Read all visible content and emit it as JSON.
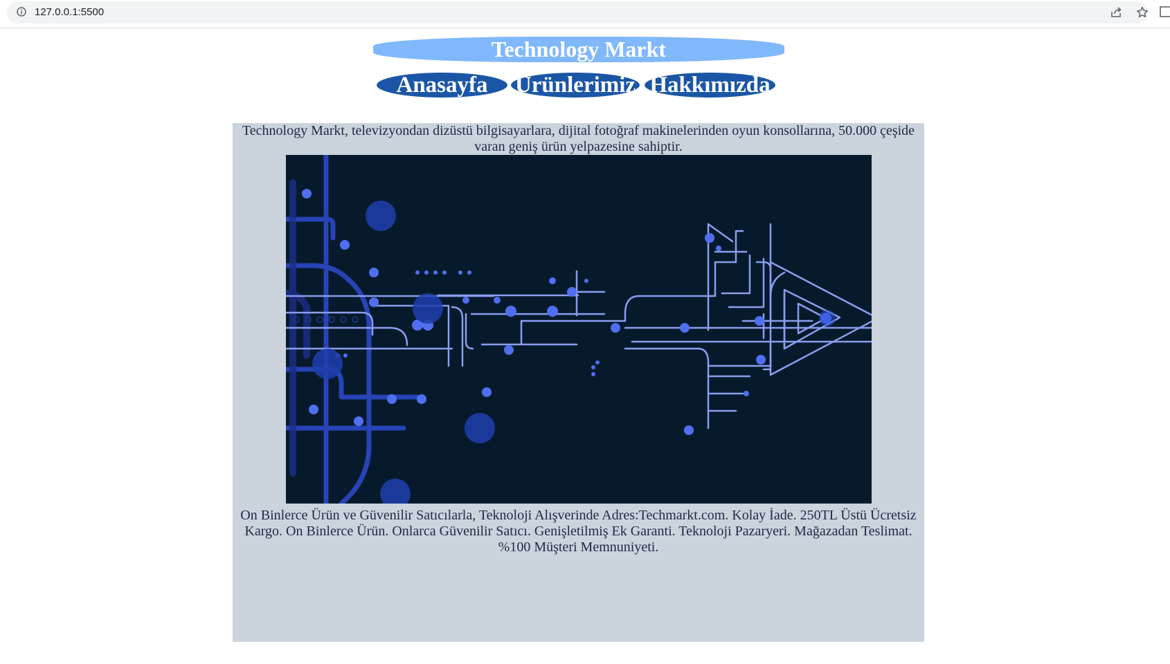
{
  "browser": {
    "url": "127.0.0.1:5500",
    "icons": [
      "info-icon",
      "share-icon",
      "star-icon",
      "side-panel-icon"
    ]
  },
  "header": {
    "title": "Technology Markt",
    "title_bg": "#80b8fc",
    "nav": [
      {
        "label": "Anasayfa"
      },
      {
        "label": "Ürünlerimiz"
      },
      {
        "label": "Hakkımızda"
      }
    ],
    "nav_bg": "#1b56a6"
  },
  "content": {
    "intro": "Technology Markt, televizyondan dizüstü bilgisayarlara, dijital fotoğraf makinelerinden oyun konsollarına, 50.000 çeşide varan geniş ürün yelpazesine sahiptir.",
    "image": {
      "subject": "circuit-board-arrow",
      "colors": {
        "background": "#061a2b",
        "line_light": "#8a9ef0",
        "line_dark": "#2b48c6",
        "node": "#4f6ff0"
      }
    },
    "bottom": "On Binlerce Ürün ve Güvenilir Satıcılarla, Teknoloji Alışverinde Adres:Techmarkt.com. Kolay İade. 250TL Üstü Ücretsiz Kargo. On Binlerce Ürün. Onlarca Güvenilir Satıcı. Genişletilmiş Ek Garanti. Teknoloji Pazaryeri. Mağazadan Teslimat. %100 Müşteri Memnuniyeti.",
    "panel_bg": "#cbd3dc"
  }
}
